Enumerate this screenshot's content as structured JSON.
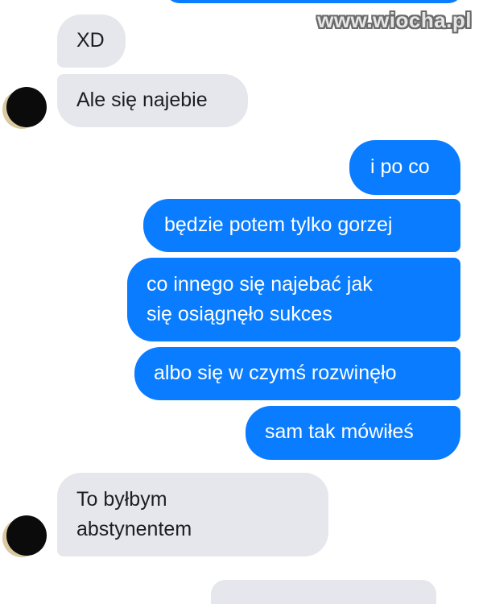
{
  "watermark": "www.wiocha.pl",
  "colors": {
    "incoming_bubble": "#e6e7ec",
    "outgoing_bubble": "#0a7cff",
    "incoming_text": "#1c1e21",
    "outgoing_text": "#ffffff"
  },
  "messages": [
    {
      "sender": "other",
      "text": "XD"
    },
    {
      "sender": "other",
      "text": "Ale się najebie"
    },
    {
      "sender": "me",
      "text": "i po co"
    },
    {
      "sender": "me",
      "text": "będzie potem tylko gorzej"
    },
    {
      "sender": "me",
      "text": "co innego się najebać jak\nsię osiągnęło sukces"
    },
    {
      "sender": "me",
      "text": "albo się w czymś rozwinęło"
    },
    {
      "sender": "me",
      "text": "sam tak mówiłeś"
    },
    {
      "sender": "other",
      "text": "To byłbym\nabstynentem"
    }
  ]
}
